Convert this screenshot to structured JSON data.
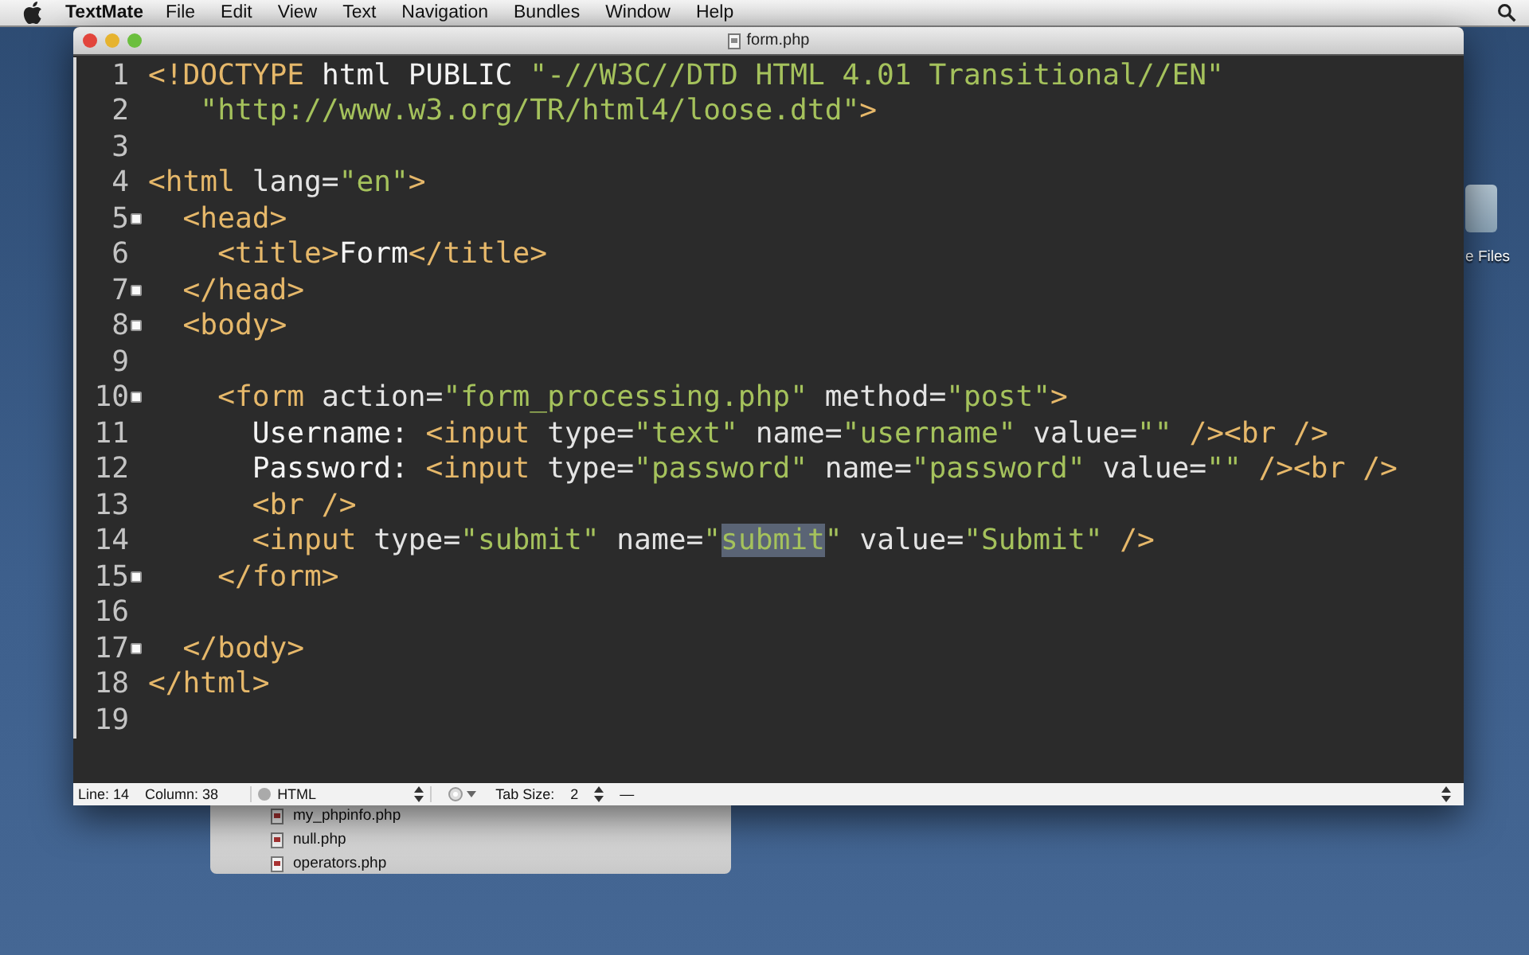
{
  "menu_bar": {
    "app": "TextMate",
    "items": [
      "File",
      "Edit",
      "View",
      "Text",
      "Navigation",
      "Bundles",
      "Window",
      "Help"
    ]
  },
  "desktop": {
    "icon_label": "e Files",
    "files": [
      "my_phpinfo.php",
      "null.php",
      "operators.php"
    ]
  },
  "window": {
    "title": "form.php"
  },
  "editor": {
    "lines": [
      {
        "number": "1",
        "fold": false,
        "tokens": [
          {
            "kind": "tag",
            "text": "<!DOCTYPE"
          },
          {
            "kind": "text",
            "text": " html PUBLIC "
          },
          {
            "kind": "string",
            "text": "\"-//W3C//DTD HTML 4.01 Transitional//EN\""
          }
        ]
      },
      {
        "number": "2",
        "fold": false,
        "tokens": [
          {
            "kind": "string",
            "text": "   \"http://www.w3.org/TR/html4/loose.dtd\""
          },
          {
            "kind": "tag",
            "text": ">"
          }
        ]
      },
      {
        "number": "3",
        "fold": false
      },
      {
        "number": "4",
        "fold": false,
        "tokens": [
          {
            "kind": "tag",
            "text": "<html"
          },
          {
            "kind": "attr",
            "text": " lang="
          },
          {
            "kind": "string",
            "text": "\"en\""
          },
          {
            "kind": "tag",
            "text": ">"
          }
        ]
      },
      {
        "number": "5",
        "fold": true,
        "tokens": [
          {
            "kind": "tag",
            "text": "  <head>"
          }
        ]
      },
      {
        "number": "6",
        "fold": false,
        "tokens": [
          {
            "kind": "tag",
            "text": "    <title>"
          },
          {
            "kind": "text",
            "text": "Form"
          },
          {
            "kind": "tag",
            "text": "</title>"
          }
        ]
      },
      {
        "number": "7",
        "fold": true,
        "tokens": [
          {
            "kind": "tag",
            "text": "  </head>"
          }
        ]
      },
      {
        "number": "8",
        "fold": true,
        "tokens": [
          {
            "kind": "tag",
            "text": "  <body>"
          }
        ]
      },
      {
        "number": "9",
        "fold": false
      },
      {
        "number": "10",
        "fold": true,
        "tokens": [
          {
            "kind": "tag",
            "text": "    <form"
          },
          {
            "kind": "attr",
            "text": " action="
          },
          {
            "kind": "string",
            "text": "\"form_processing.php\""
          },
          {
            "kind": "attr",
            "text": " method="
          },
          {
            "kind": "string",
            "text": "\"post\""
          },
          {
            "kind": "tag",
            "text": ">"
          }
        ]
      },
      {
        "number": "11",
        "fold": false,
        "tokens": [
          {
            "kind": "text",
            "text": "      Username: "
          },
          {
            "kind": "tag",
            "text": "<input"
          },
          {
            "kind": "attr",
            "text": " type="
          },
          {
            "kind": "string",
            "text": "\"text\""
          },
          {
            "kind": "attr",
            "text": " name="
          },
          {
            "kind": "string",
            "text": "\"username\""
          },
          {
            "kind": "attr",
            "text": " value="
          },
          {
            "kind": "string",
            "text": "\"\""
          },
          {
            "kind": "tag",
            "text": " /><br />"
          }
        ]
      },
      {
        "number": "12",
        "fold": false,
        "tokens": [
          {
            "kind": "text",
            "text": "      Password: "
          },
          {
            "kind": "tag",
            "text": "<input"
          },
          {
            "kind": "attr",
            "text": " type="
          },
          {
            "kind": "string",
            "text": "\"password\""
          },
          {
            "kind": "attr",
            "text": " name="
          },
          {
            "kind": "string",
            "text": "\"password\""
          },
          {
            "kind": "attr",
            "text": " value="
          },
          {
            "kind": "string",
            "text": "\"\""
          },
          {
            "kind": "tag",
            "text": " /><br />"
          }
        ]
      },
      {
        "number": "13",
        "fold": false,
        "tokens": [
          {
            "kind": "tag",
            "text": "      <br />"
          }
        ]
      },
      {
        "number": "14",
        "fold": false,
        "tokens": [
          {
            "kind": "tag",
            "text": "      <input"
          },
          {
            "kind": "attr",
            "text": " type="
          },
          {
            "kind": "string",
            "text": "\"submit\""
          },
          {
            "kind": "attr",
            "text": " name="
          },
          {
            "kind": "string",
            "text": "\""
          },
          {
            "kind": "string",
            "text": "submit",
            "selected": true
          },
          {
            "kind": "string",
            "text": "\""
          },
          {
            "kind": "attr",
            "text": " value="
          },
          {
            "kind": "string",
            "text": "\"Submit\""
          },
          {
            "kind": "tag",
            "text": " />"
          }
        ]
      },
      {
        "number": "15",
        "fold": true,
        "tokens": [
          {
            "kind": "tag",
            "text": "    </form>"
          }
        ]
      },
      {
        "number": "16",
        "fold": false
      },
      {
        "number": "17",
        "fold": true,
        "tokens": [
          {
            "kind": "tag",
            "text": "  </body>"
          }
        ]
      },
      {
        "number": "18",
        "fold": false,
        "tokens": [
          {
            "kind": "tag",
            "text": "</html>"
          }
        ]
      },
      {
        "number": "19",
        "fold": false
      }
    ]
  },
  "status_bar": {
    "line": "Line: 14",
    "column": "Column: 38",
    "language": "HTML",
    "tab_size_label": "Tab Size:",
    "tab_size": "2",
    "symbol": "—"
  }
}
